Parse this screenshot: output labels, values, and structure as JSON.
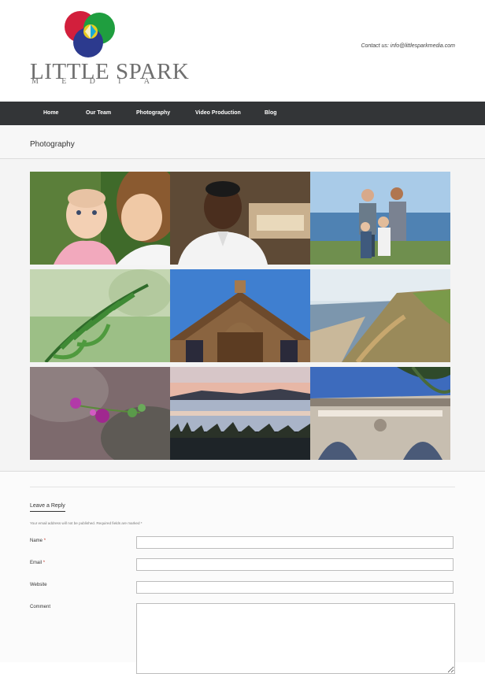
{
  "brand": {
    "name": "LITTLE SPARK",
    "sub_letters": [
      "M",
      "E",
      "D",
      "I",
      "A"
    ],
    "colors": {
      "red": "#d21f3c",
      "green": "#1f9e3f",
      "blue": "#2c3a8e",
      "yellow": "#f2d21b",
      "cyan": "#17a8d8"
    }
  },
  "header": {
    "contact": "Contact us: info@littlesparkmedia.com"
  },
  "nav": {
    "items": [
      "Home",
      "Our Team",
      "Photography",
      "Video Production",
      "Blog"
    ]
  },
  "page": {
    "title": "Photography"
  },
  "gallery": {
    "photos": [
      {
        "subject": "Mother and baby"
      },
      {
        "subject": "Chef portrait"
      },
      {
        "subject": "Family on coast"
      },
      {
        "subject": "Fern leaves"
      },
      {
        "subject": "Wooden church"
      },
      {
        "subject": "Coastal cliffs"
      },
      {
        "subject": "Purple flowers"
      },
      {
        "subject": "Lake at sunset"
      },
      {
        "subject": "Historic building"
      }
    ]
  },
  "comment_form": {
    "heading": "Leave a Reply",
    "note": "Your email address will not be published. Required fields are marked *",
    "fields": {
      "name": {
        "label": "Name",
        "required": "*"
      },
      "email": {
        "label": "Email",
        "required": "*"
      },
      "website": {
        "label": "Website"
      },
      "comment": {
        "label": "Comment"
      }
    }
  }
}
